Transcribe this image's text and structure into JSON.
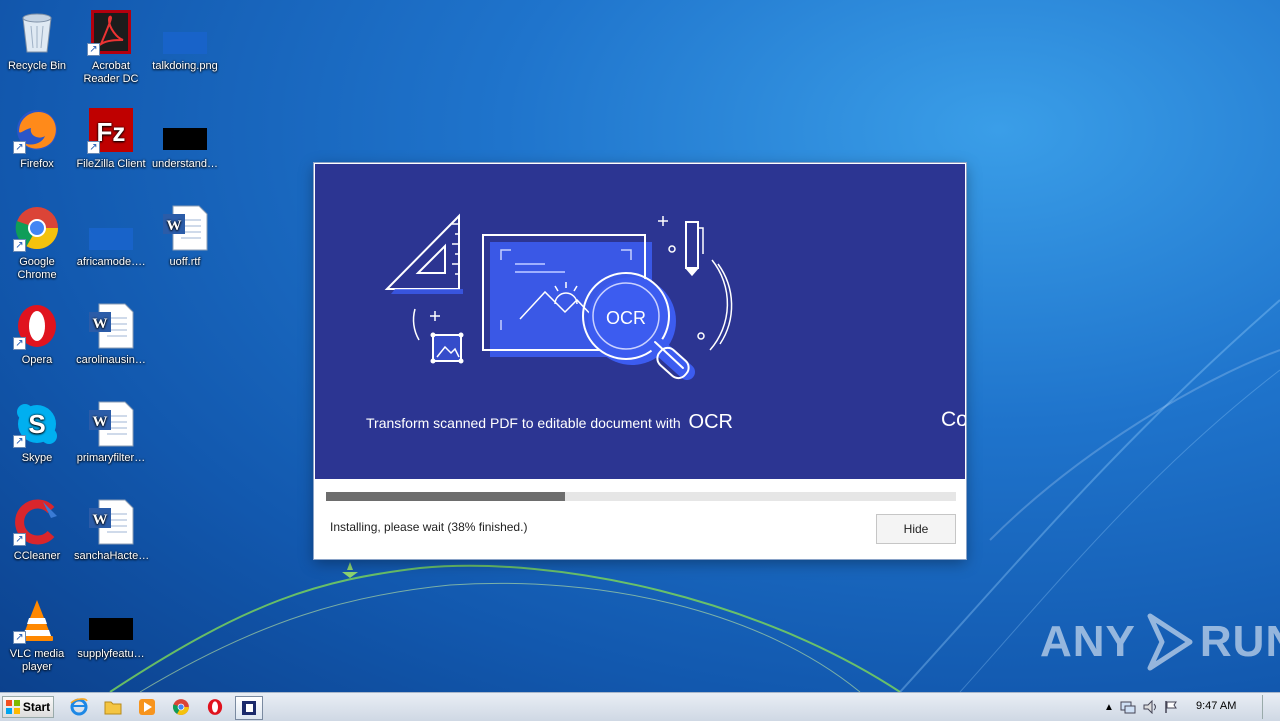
{
  "desktop": {
    "icons": [
      {
        "label": "Recycle Bin",
        "icon": "recycle-bin-icon"
      },
      {
        "label": "Acrobat\nReader DC",
        "icon": "acrobat-icon"
      },
      {
        "label": "talkdoing.png",
        "icon": "image-file-icon"
      },
      {
        "label": "Firefox",
        "icon": "firefox-icon"
      },
      {
        "label": "FileZilla Client",
        "icon": "filezilla-icon"
      },
      {
        "label": "understand…",
        "icon": "black-file-icon"
      },
      {
        "label": "Google\nChrome",
        "icon": "chrome-icon"
      },
      {
        "label": "africamode….",
        "icon": "blue-file-icon"
      },
      {
        "label": "uoff.rtf",
        "icon": "word-doc-icon"
      },
      {
        "label": "Opera",
        "icon": "opera-icon"
      },
      {
        "label": "carolinausin…",
        "icon": "word-doc-icon"
      },
      {
        "label": "Skype",
        "icon": "skype-icon"
      },
      {
        "label": "primaryfilter…",
        "icon": "word-doc-icon"
      },
      {
        "label": "CCleaner",
        "icon": "ccleaner-icon"
      },
      {
        "label": "sanchaHacte…",
        "icon": "word-doc-icon"
      },
      {
        "label": "VLC media\nplayer",
        "icon": "vlc-icon"
      },
      {
        "label": "supplyfeatu…",
        "icon": "black-file-icon"
      }
    ]
  },
  "installer": {
    "banner_text": "Transform scanned PDF to editable document with",
    "banner_text_strong": "OCR",
    "banner_next_text": "Co",
    "badge_text": "OCR",
    "progress": 0.38,
    "status": "Installing, please wait (38% finished.)",
    "hide_button": "Hide"
  },
  "watermark": {
    "left": "ANY",
    "right": "RUN"
  },
  "taskbar": {
    "start_label": "Start",
    "icons": [
      "ie-icon",
      "explorer-icon",
      "media-player-icon",
      "chrome-icon",
      "opera-icon",
      "installer-task-icon"
    ],
    "tray_icons": [
      "tray-arrow-icon",
      "network-icon",
      "volume-icon",
      "flag-icon"
    ],
    "clock": "9:47 AM"
  },
  "colors": {
    "banner": "#2c3592",
    "accent": "#3c5cf0"
  }
}
